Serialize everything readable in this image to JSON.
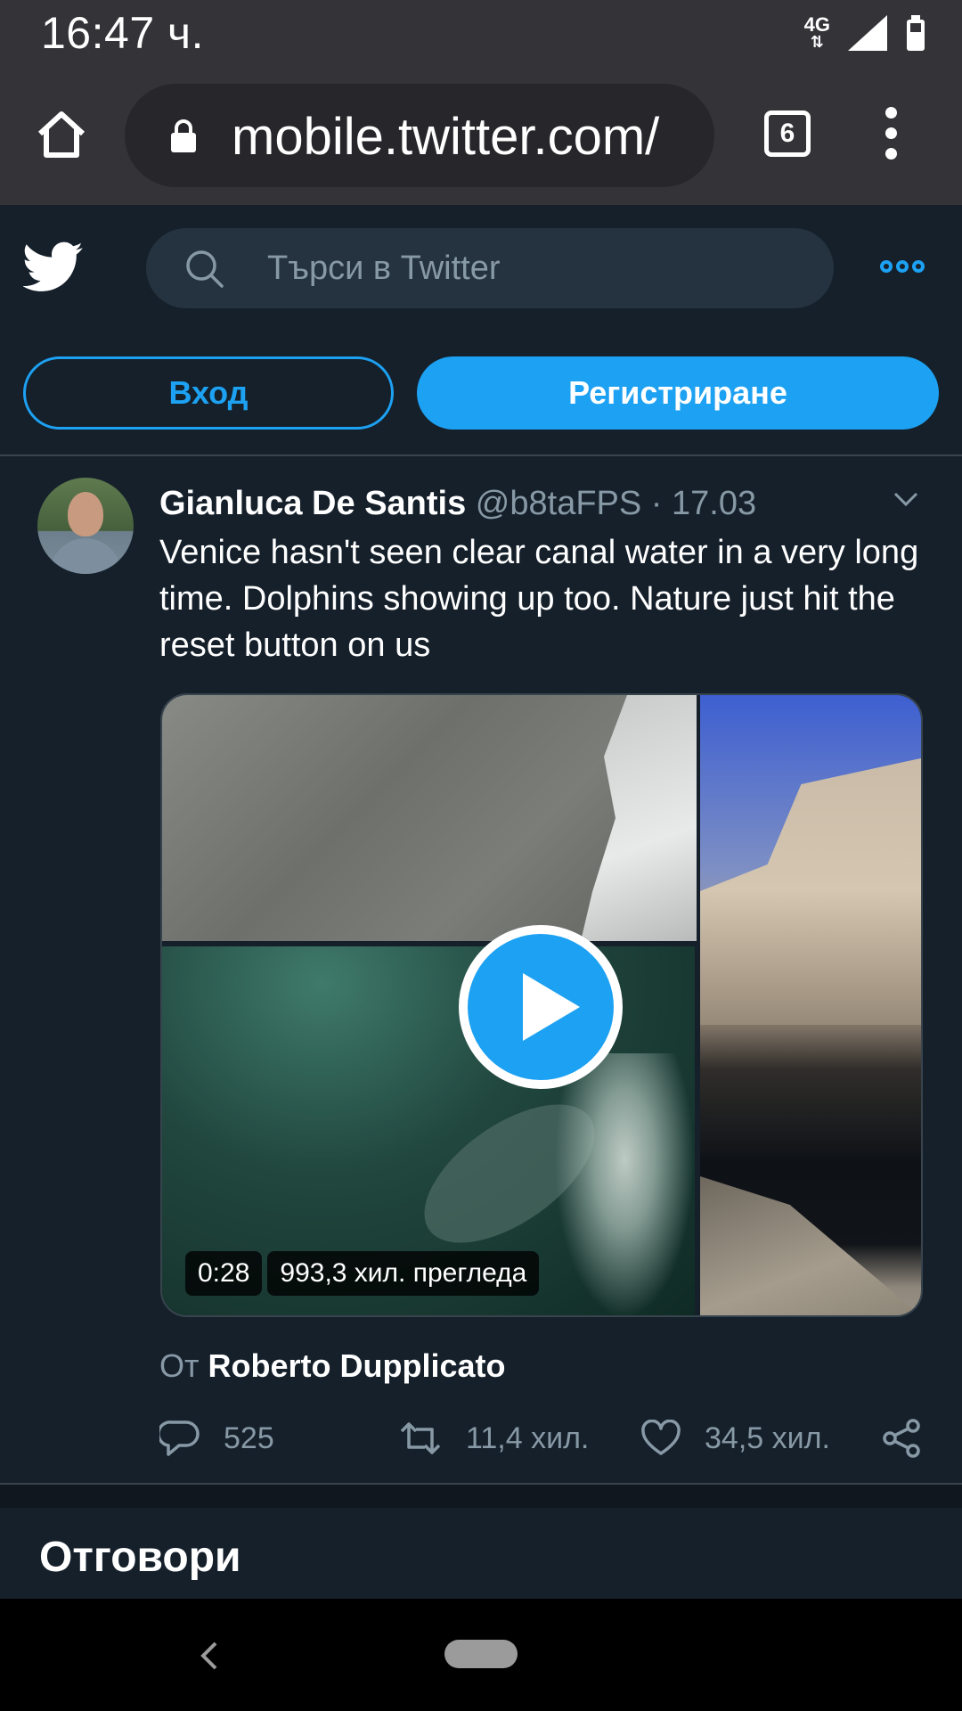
{
  "status_bar": {
    "time": "16:47 ч.",
    "network": "4G"
  },
  "browser": {
    "url": "mobile.twitter.com/",
    "tab_count": "6"
  },
  "header": {
    "search_placeholder": "Търси в Twitter",
    "login_label": "Вход",
    "signup_label": "Регистриране"
  },
  "tweet": {
    "author_name": "Gianluca De Santis",
    "author_handle": "@b8taFPS",
    "separator": "·",
    "date": "17.03",
    "text": "Venice hasn't seen clear canal water in a very long time. Dolphins showing up too. Nature just hit the reset button on us",
    "video": {
      "duration": "0:28",
      "views": "993,3 хил. прегледа"
    },
    "attribution_prefix": "От",
    "attribution_name": "Roberto Dupplicato",
    "replies": "525",
    "retweets": "11,4 хил.",
    "likes": "34,5 хил."
  },
  "replies_section": {
    "title": "Отговори"
  },
  "colors": {
    "background": "#15202b",
    "accent": "#1da1f2",
    "muted": "#8899a6",
    "chrome": "#333338"
  }
}
